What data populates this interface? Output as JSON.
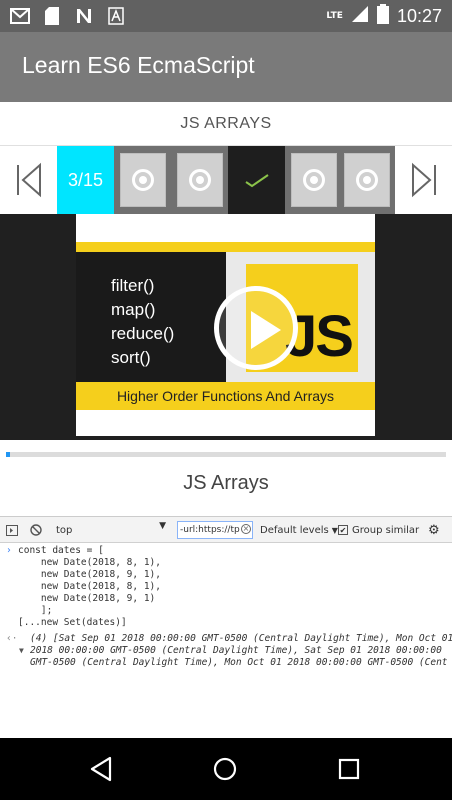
{
  "status_bar": {
    "time": "10:27",
    "network": "LTE",
    "left_icons": [
      "gmail-icon",
      "sd-card-icon",
      "n-app-icon",
      "font-a-icon"
    ]
  },
  "app_bar": {
    "title": "Learn ES6 EcmaScript"
  },
  "section": {
    "title": "JS ARRAYS"
  },
  "pager": {
    "counter": "3/15",
    "slots": [
      "record",
      "record",
      "check",
      "record",
      "record"
    ]
  },
  "video": {
    "code_items": [
      "filter()",
      "map()",
      "reduce()",
      "sort()"
    ],
    "logo_text": "JS",
    "banner": "Higher Order Functions And Arrays",
    "progress_fraction": 0.01
  },
  "lesson": {
    "title": "JS Arrays"
  },
  "console": {
    "context": "top",
    "filter_value": "-url:https://tp",
    "levels_label": "Default levels",
    "group_similar_label": "Group similar",
    "group_similar_checked": true,
    "input_lines": [
      "const dates = [",
      "    new Date(2018, 8, 1),",
      "    new Date(2018, 9, 1),",
      "    new Date(2018, 8, 1),",
      "    new Date(2018, 9, 1)",
      "    ];",
      "[...new Set(dates)]"
    ],
    "output_lines": [
      "(4) [Sat Sep 01 2018 00:00:00 GMT-0500 (Central Daylight Time), Mon Oct 01",
      "2018 00:00:00 GMT-0500 (Central Daylight Time), Sat Sep 01 2018 00:00:00",
      "GMT-0500 (Central Daylight Time), Mon Oct 01 2018 00:00:00 GMT-0500 (Cent"
    ]
  },
  "colors": {
    "accent": "#00e5ff",
    "js_yellow": "#f5cf1c",
    "app_bar": "#7a7a7a",
    "status_bar": "#616161"
  }
}
